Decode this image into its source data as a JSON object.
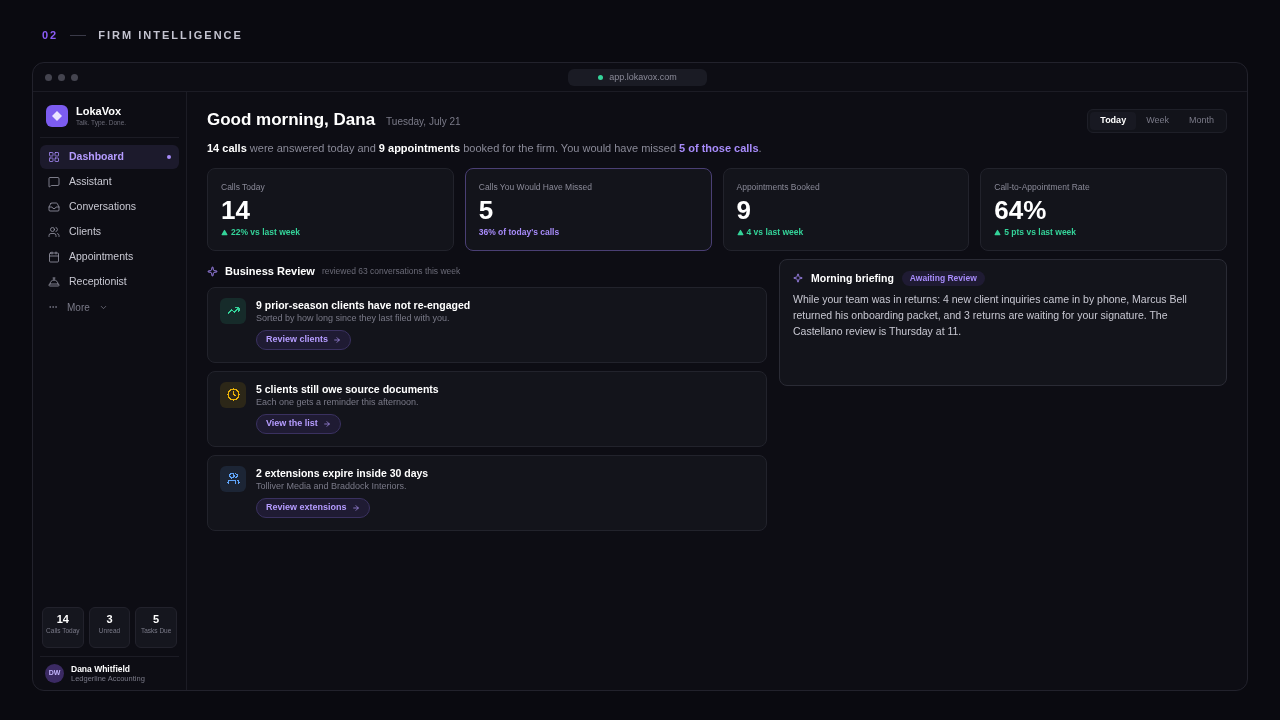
{
  "section": {
    "number": "02",
    "title": "FIRM INTELLIGENCE"
  },
  "browser": {
    "url": "app.lokavox.com"
  },
  "brand": {
    "name": "LokaVox",
    "tagline": "Talk. Type. Done."
  },
  "nav": [
    {
      "label": "Dashboard",
      "selected": true
    },
    {
      "label": "Assistant",
      "selected": false
    },
    {
      "label": "Conversations",
      "selected": false
    },
    {
      "label": "Clients",
      "selected": false
    },
    {
      "label": "Appointments",
      "selected": false
    },
    {
      "label": "Receptionist",
      "selected": false
    }
  ],
  "more": {
    "label": "More"
  },
  "mini_stats": [
    {
      "value": "14",
      "label": "Calls Today"
    },
    {
      "value": "3",
      "label": "Unread"
    },
    {
      "value": "5",
      "label": "Tasks Due"
    }
  ],
  "user": {
    "initials": "DW",
    "name": "Dana Whitfield",
    "org": "Ledgerline Accounting"
  },
  "greeting": {
    "title": "Good morning, Dana",
    "date": "Tuesday, July 21"
  },
  "range_tabs": [
    {
      "label": "Today",
      "selected": true
    },
    {
      "label": "Week",
      "selected": false
    },
    {
      "label": "Month",
      "selected": false
    }
  ],
  "summary": [
    {
      "text": "14 calls",
      "kind": "bold"
    },
    {
      "text": " were answered today and ",
      "kind": "plain"
    },
    {
      "text": "9 appointments",
      "kind": "bold"
    },
    {
      "text": " booked for the firm. You would have missed ",
      "kind": "plain"
    },
    {
      "text": "5 of those calls",
      "kind": "accent"
    },
    {
      "text": ".",
      "kind": "plain"
    }
  ],
  "stats": [
    {
      "label": "Calls Today",
      "value": "14",
      "note": "22% vs last week",
      "kind": "up",
      "highlighted": false
    },
    {
      "label": "Calls You Would Have Missed",
      "value": "5",
      "note": "36% of today's calls",
      "kind": "share",
      "highlighted": true
    },
    {
      "label": "Appointments Booked",
      "value": "9",
      "note": "4 vs last week",
      "kind": "up",
      "highlighted": false
    },
    {
      "label": "Call-to-Appointment Rate",
      "value": "64%",
      "note": "5 pts vs last week",
      "kind": "up",
      "highlighted": false
    }
  ],
  "review": {
    "title": "Business Review",
    "subtitle": "reviewed 63 conversations this week",
    "items": [
      {
        "kind": "trend",
        "color": "#34d399",
        "title": "9 prior-season clients have not re-engaged",
        "text": "Sorted by how long since they last filed with you.",
        "action": "Review clients"
      },
      {
        "kind": "clock",
        "color": "#eab308",
        "title": "5 clients still owe source documents",
        "text": "Each one gets a reminder this afternoon.",
        "action": "View the list"
      },
      {
        "kind": "users",
        "color": "#60a5fa",
        "title": "2 extensions expire inside 30 days",
        "text": "Tolliver Media and Braddock Interiors.",
        "action": "Review extensions"
      }
    ]
  },
  "briefing": {
    "title": "Morning briefing",
    "badge": "Awaiting Review",
    "text": "While your team was in returns: 4 new client inquiries came in by phone, Marcus Bell returned his onboarding packet, and 3 returns are waiting for your signature. The Castellano review is Thursday at 11."
  }
}
